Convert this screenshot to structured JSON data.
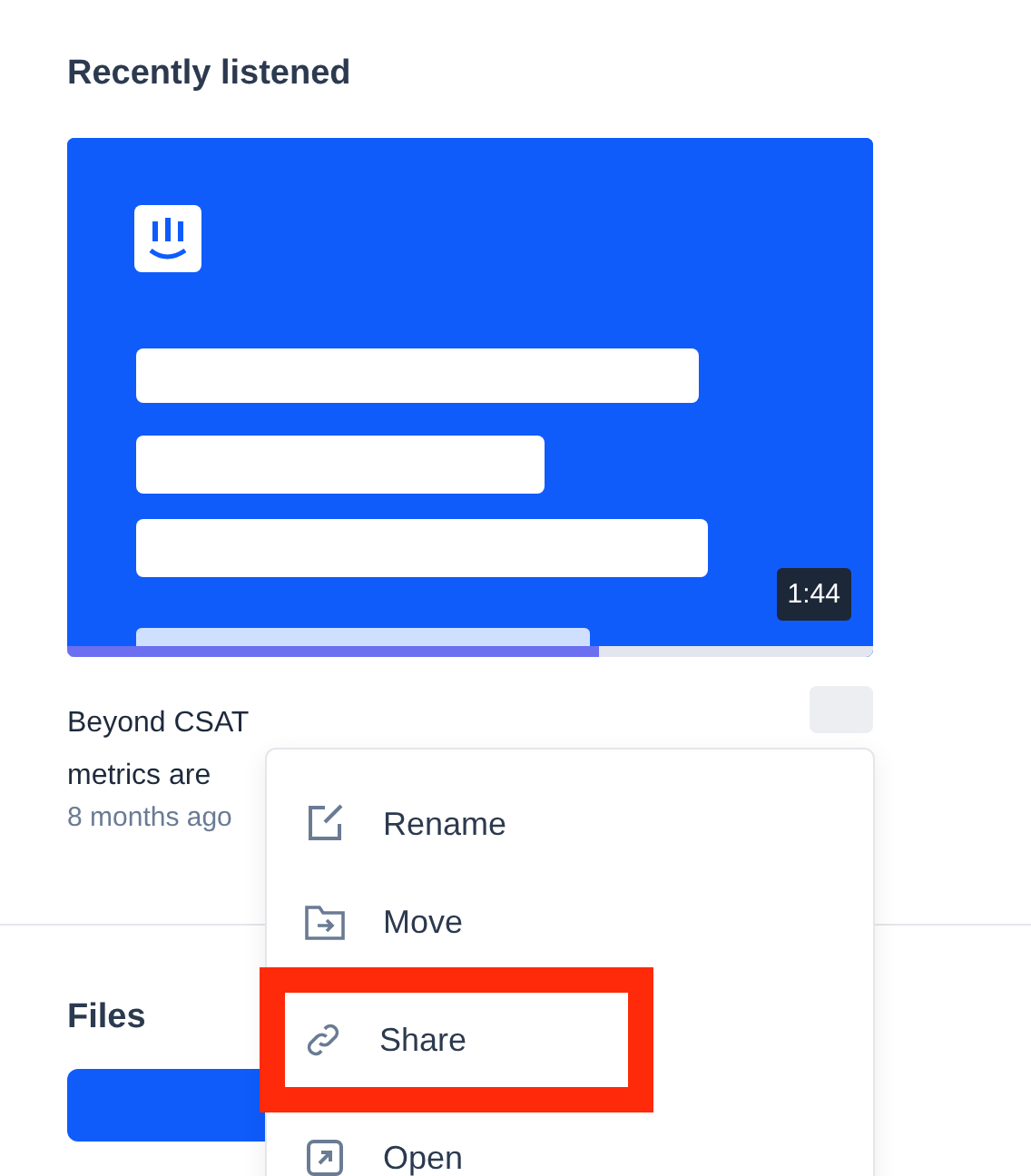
{
  "recent": {
    "heading": "Recently listened",
    "item": {
      "duration": "1:44",
      "level": 0.66,
      "title_lines": [
        "Beyond CSAT",
        "metrics are"
      ],
      "age": "8 months ago"
    }
  },
  "menu": {
    "items": [
      {
        "kind": "rename",
        "label": "Rename",
        "highlighted": false
      },
      {
        "kind": "move",
        "label": "Move",
        "highlighted": false
      },
      {
        "kind": "share",
        "label": "Share",
        "highlighted": true
      },
      {
        "kind": "open",
        "label": "Open",
        "highlighted": false
      }
    ]
  },
  "files": {
    "heading": "Files"
  }
}
